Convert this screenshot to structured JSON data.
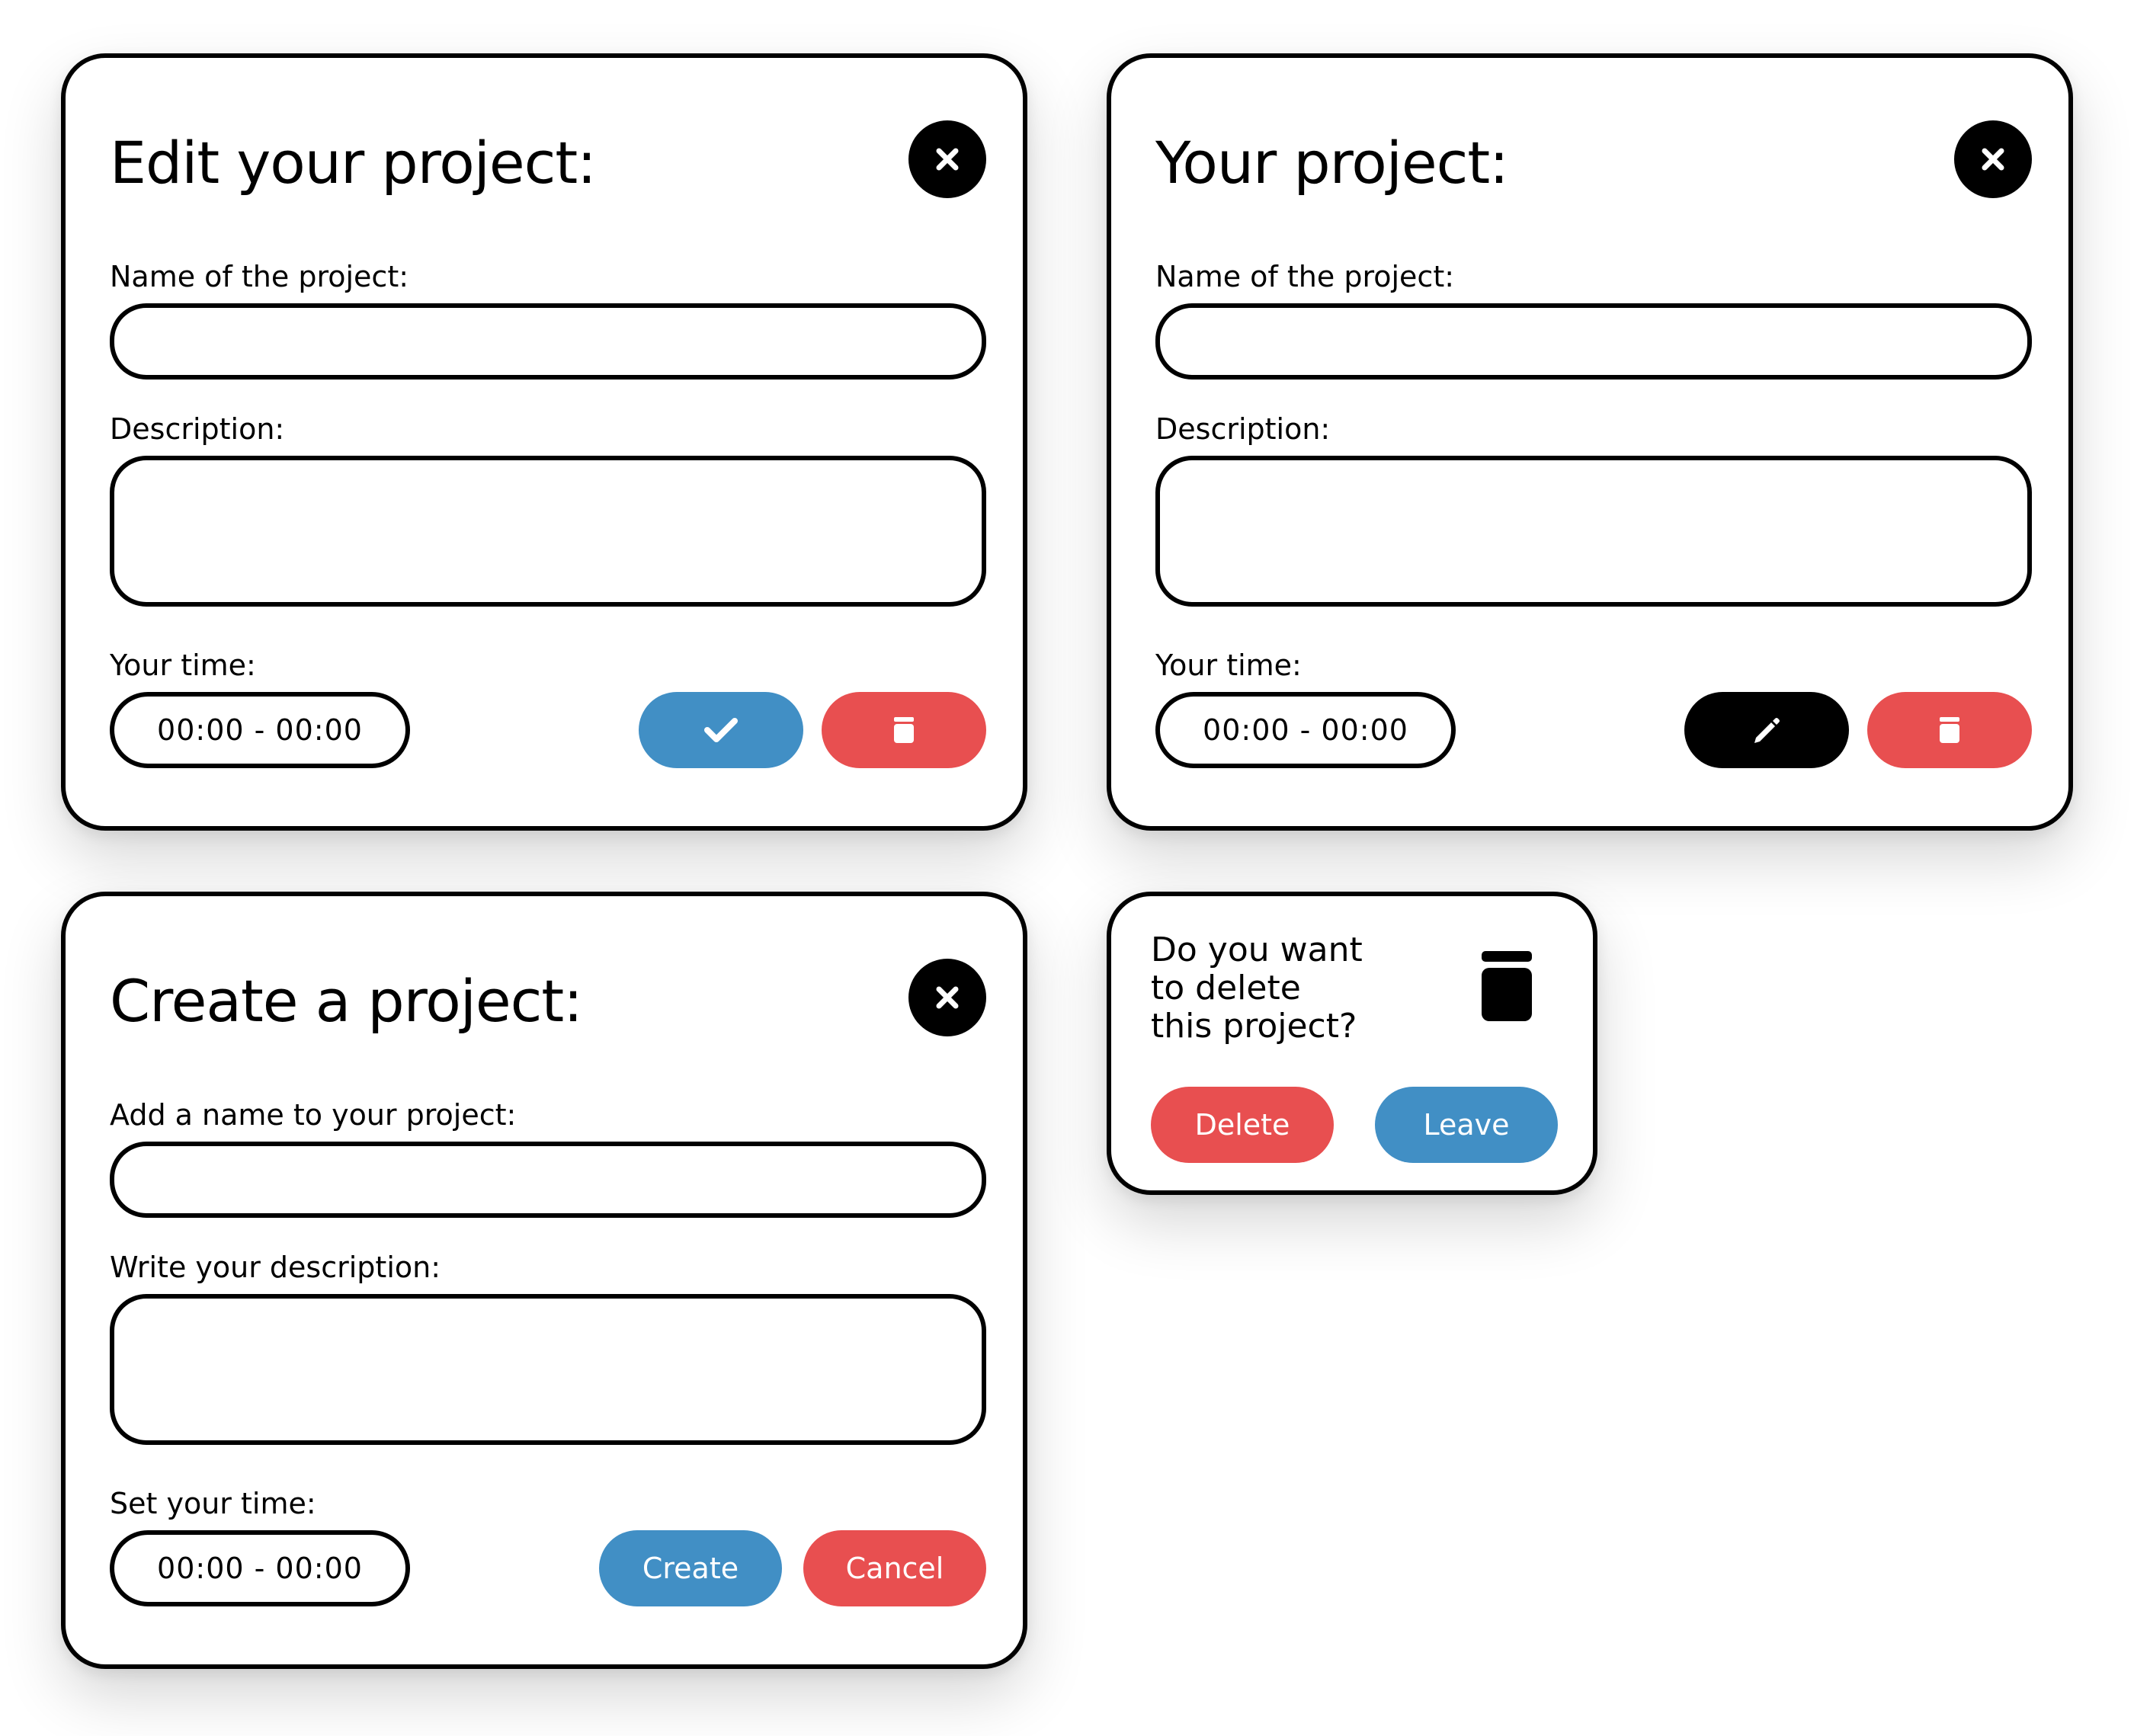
{
  "edit_dialog": {
    "title": "Edit your project:",
    "close_icon": "close-icon",
    "name_label": "Name of the project:",
    "name_value": "",
    "description_label": "Description:",
    "description_value": "",
    "time_label": "Your time:",
    "time_value": "00:00 - 00:00",
    "confirm_icon": "checkmark-icon",
    "delete_icon": "trash-icon"
  },
  "view_dialog": {
    "title": "Your project:",
    "close_icon": "close-icon",
    "name_label": "Name of the project:",
    "name_value": "",
    "description_label": "Description:",
    "description_value": "",
    "time_label": "Your time:",
    "time_value": "00:00 - 00:00",
    "edit_icon": "pencil-icon",
    "delete_icon": "trash-icon"
  },
  "create_dialog": {
    "title": "Create a project:",
    "close_icon": "close-icon",
    "name_label": "Add a name to your project:",
    "name_value": "",
    "description_label": "Write your description:",
    "description_value": "",
    "time_label": "Set your time:",
    "time_value": "00:00 - 00:00",
    "create_label": "Create",
    "cancel_label": "Cancel"
  },
  "delete_confirm": {
    "question_lines": [
      "Do you want",
      "to delete",
      "this project?"
    ],
    "icon": "trash-icon",
    "delete_label": "Delete",
    "leave_label": "Leave"
  },
  "colors": {
    "primary_blue": "#418fc5",
    "danger_red": "#e84f50",
    "black": "#000000",
    "background": "#ffffff"
  }
}
